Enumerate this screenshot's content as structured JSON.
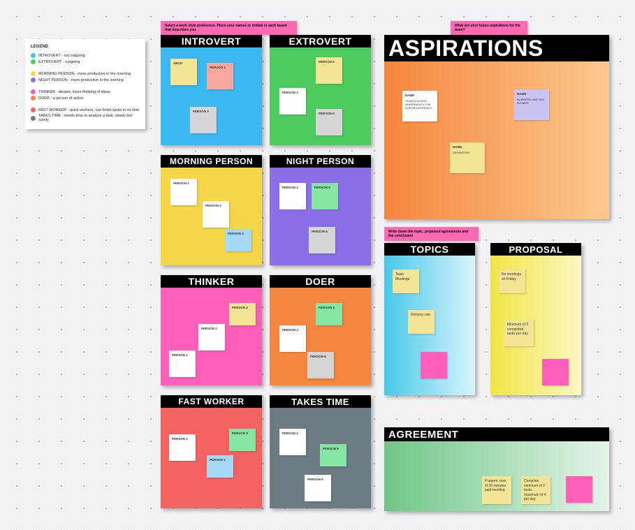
{
  "legend": {
    "title": "LEGEND",
    "items": [
      {
        "color": "#3fc3ee",
        "text": "INTROVERT - not outgoing"
      },
      {
        "color": "#4fce5a",
        "text": "EXTROVERT - outgoing"
      },
      null,
      {
        "color": "#f3d84d",
        "text": "MORNING PERSON - more productive in the morning"
      },
      {
        "color": "#8c6fe8",
        "text": "NIGHT PERSON - more productive in the evening"
      },
      null,
      {
        "color": "#ff5fba",
        "text": "THINKER - ideator, loves thinking of ideas"
      },
      {
        "color": "#f5863f",
        "text": "DOER - a person of action"
      },
      null,
      {
        "color": "#f56262",
        "text": "FAST WORKER - quick workers, can finish tasks in no time"
      },
      {
        "color": "#6d7b85",
        "text": "TAKES TIME - needs time to analyze a task, slowly but surely"
      }
    ]
  },
  "hints": {
    "h1": "Select a work style preference. Place your names or initials in each board that describes you.",
    "h2": "What are your future aspirations for the team?",
    "h3": "Write down the topic, proposed agreements and the conclusion"
  },
  "boards": {
    "introvert": {
      "title": "INTROVERT",
      "stickies": [
        {
          "label": "ABCD",
          "color": "#f4e596"
        },
        {
          "label": "PERSON 2",
          "color": "#f9a8a0"
        },
        {
          "label": "PERSON 3",
          "color": "#d6d6d6"
        }
      ]
    },
    "extrovert": {
      "title": "EXTROVERT",
      "stickies": [
        {
          "label": "PERSON 5",
          "color": "#f4e596"
        },
        {
          "label": "PERSON 4",
          "color": "#ffffff"
        },
        {
          "label": "PERSON 6",
          "color": "#d6d6d6"
        }
      ]
    },
    "morning": {
      "title": "MORNING PERSON",
      "stickies": [
        {
          "label": "PERSON 1",
          "color": "#ffffff"
        },
        {
          "label": "PERSON 2",
          "color": "#ffffff"
        },
        {
          "label": "PERSON 3",
          "color": "#a6d9f7"
        }
      ]
    },
    "night": {
      "title": "NIGHT PERSON",
      "stickies": [
        {
          "label": "PERSON 4",
          "color": "#ffffff"
        },
        {
          "label": "PERSON 5",
          "color": "#84e6a0"
        },
        {
          "label": "PERSON 6",
          "color": "#d6d6d6"
        }
      ]
    },
    "thinker": {
      "title": "THINKER",
      "stickies": [
        {
          "label": "PERSON 3",
          "color": "#f4e596"
        },
        {
          "label": "PERSON 2",
          "color": "#ffffff"
        },
        {
          "label": "PERSON 1",
          "color": "#ffffff"
        }
      ]
    },
    "doer": {
      "title": "DOER",
      "stickies": [
        {
          "label": "PERSON 5",
          "color": "#84e6a0"
        },
        {
          "label": "PERSON 4",
          "color": "#ffffff"
        },
        {
          "label": "PERSON 6",
          "color": "#d6d6d6"
        }
      ]
    },
    "fast": {
      "title": "FAST WORKER",
      "stickies": [
        {
          "label": "PERSON 1",
          "color": "#ffffff"
        },
        {
          "label": "PERSON 3",
          "color": "#84e6a0"
        },
        {
          "label": "PERSON 2",
          "color": "#a6d9f7"
        }
      ]
    },
    "takes": {
      "title": "TAKES TIME",
      "stickies": [
        {
          "label": "PERSON 4",
          "color": "#ffffff"
        },
        {
          "label": "PERSON 5",
          "color": "#84e6a0"
        },
        {
          "label": "PERSON 6",
          "color": "#ffffff"
        }
      ]
    },
    "aspirations": {
      "title": "ASPIRATIONS",
      "stickies": [
        {
          "name": "NAME",
          "sub": "TEAM BUILDING UNDERNEATH THE AURORA BOREALIS",
          "color": "#ffffff"
        },
        {
          "name": "NAME",
          "sub": "BUSINESS MEETING IN PARIS",
          "color": "#cbc4f2"
        },
        {
          "name": "NAME",
          "sub": "ASPIRATION",
          "color": "#f4e596"
        }
      ]
    },
    "topics": {
      "title": "TOPICS",
      "stickies": [
        {
          "label": "Team Meetings",
          "color": "#f4e596"
        },
        {
          "label": "Delivery rate",
          "color": "#f4e596"
        },
        {
          "label": "",
          "color": "#ff5fba"
        }
      ]
    },
    "proposal": {
      "title": "PROPOSAL",
      "stickies": [
        {
          "label": "No meetings on Friday",
          "color": "#f4e596"
        },
        {
          "label": "Minimum of 2 completed tasks per day",
          "color": "#f4e596"
        },
        {
          "label": "",
          "color": "#ff5fba"
        }
      ]
    },
    "agreement": {
      "title": "AGREEMENT",
      "stickies": [
        {
          "label": "If urgent, max of 30 minutes paid meeting",
          "color": "#f4e596"
        },
        {
          "label": "Complete minimum of 2 tasks, maximum of 4 per day",
          "color": "#f4e596"
        },
        {
          "label": "",
          "color": "#ff5fba"
        }
      ]
    }
  }
}
